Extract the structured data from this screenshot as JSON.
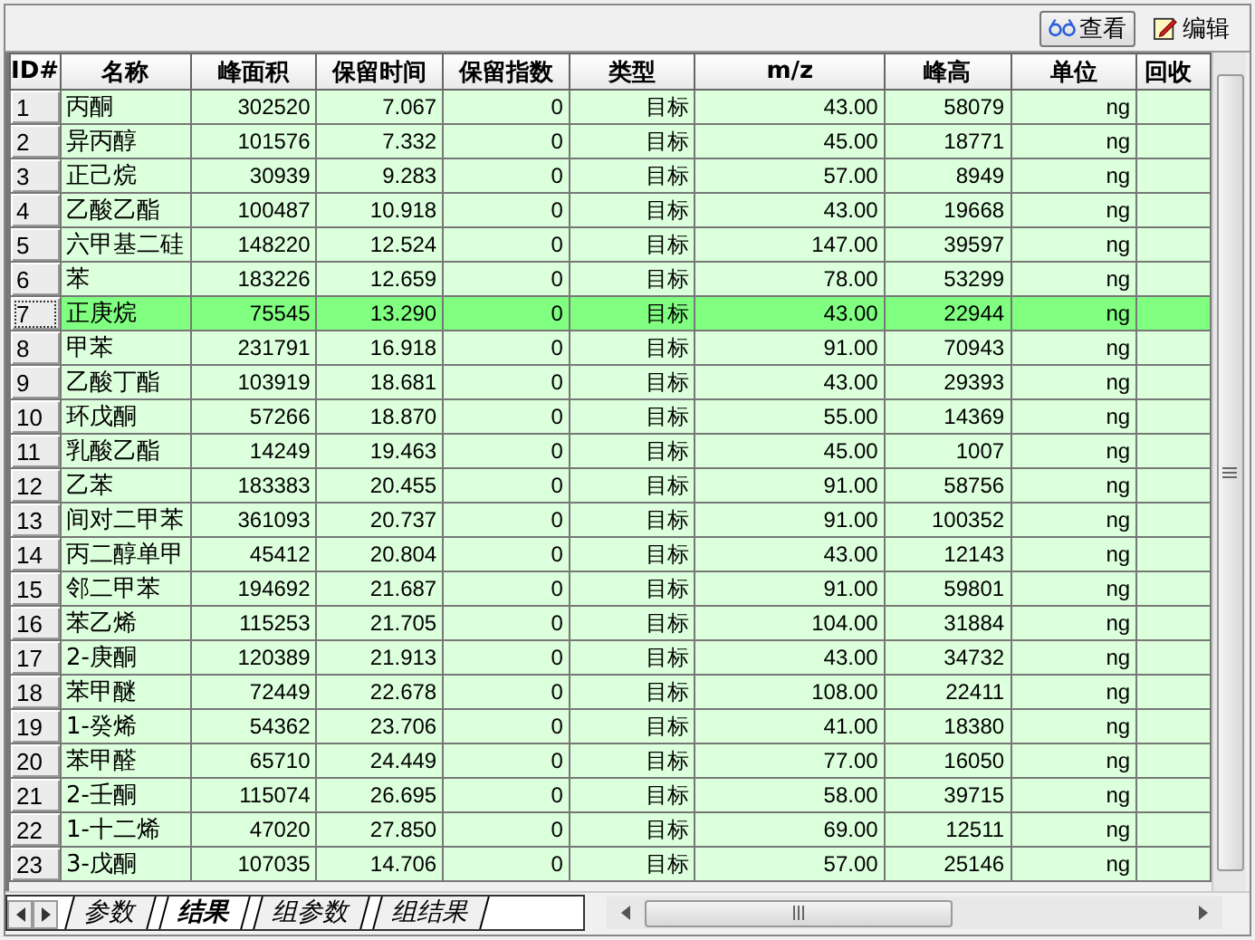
{
  "toolbar": {
    "buttons": [
      {
        "label": "查看",
        "kind": "view",
        "pressed": true
      },
      {
        "label": "编辑",
        "kind": "edit",
        "pressed": false
      }
    ]
  },
  "table": {
    "columns": [
      {
        "label": "ID#"
      },
      {
        "label": "名称"
      },
      {
        "label": "峰面积"
      },
      {
        "label": "保留时间"
      },
      {
        "label": "保留指数"
      },
      {
        "label": "类型"
      },
      {
        "label": "m/z"
      },
      {
        "label": "峰高"
      },
      {
        "label": "单位"
      },
      {
        "label": "回收"
      }
    ],
    "rows": [
      {
        "cells": [
          "1",
          "丙酮",
          "302520",
          "7.067",
          "0",
          "目标",
          "43.00",
          "58079",
          "ng"
        ],
        "selected": false
      },
      {
        "cells": [
          "2",
          "异丙醇",
          "101576",
          "7.332",
          "0",
          "目标",
          "45.00",
          "18771",
          "ng"
        ],
        "selected": false
      },
      {
        "cells": [
          "3",
          "正己烷",
          "30939",
          "9.283",
          "0",
          "目标",
          "57.00",
          "8949",
          "ng"
        ],
        "selected": false
      },
      {
        "cells": [
          "4",
          "乙酸乙酯",
          "100487",
          "10.918",
          "0",
          "目标",
          "43.00",
          "19668",
          "ng"
        ],
        "selected": false
      },
      {
        "cells": [
          "5",
          "六甲基二硅",
          "148220",
          "12.524",
          "0",
          "目标",
          "147.00",
          "39597",
          "ng"
        ],
        "selected": false
      },
      {
        "cells": [
          "6",
          "苯",
          "183226",
          "12.659",
          "0",
          "目标",
          "78.00",
          "53299",
          "ng"
        ],
        "selected": false
      },
      {
        "cells": [
          "7",
          "正庚烷",
          "75545",
          "13.290",
          "0",
          "目标",
          "43.00",
          "22944",
          "ng"
        ],
        "selected": true
      },
      {
        "cells": [
          "8",
          "甲苯",
          "231791",
          "16.918",
          "0",
          "目标",
          "91.00",
          "70943",
          "ng"
        ],
        "selected": false
      },
      {
        "cells": [
          "9",
          "乙酸丁酯",
          "103919",
          "18.681",
          "0",
          "目标",
          "43.00",
          "29393",
          "ng"
        ],
        "selected": false
      },
      {
        "cells": [
          "10",
          "环戊酮",
          "57266",
          "18.870",
          "0",
          "目标",
          "55.00",
          "14369",
          "ng"
        ],
        "selected": false
      },
      {
        "cells": [
          "11",
          "乳酸乙酯",
          "14249",
          "19.463",
          "0",
          "目标",
          "45.00",
          "1007",
          "ng"
        ],
        "selected": false
      },
      {
        "cells": [
          "12",
          "乙苯",
          "183383",
          "20.455",
          "0",
          "目标",
          "91.00",
          "58756",
          "ng"
        ],
        "selected": false
      },
      {
        "cells": [
          "13",
          "间对二甲苯",
          "361093",
          "20.737",
          "0",
          "目标",
          "91.00",
          "100352",
          "ng"
        ],
        "selected": false
      },
      {
        "cells": [
          "14",
          "丙二醇单甲",
          "45412",
          "20.804",
          "0",
          "目标",
          "43.00",
          "12143",
          "ng"
        ],
        "selected": false
      },
      {
        "cells": [
          "15",
          "邻二甲苯",
          "194692",
          "21.687",
          "0",
          "目标",
          "91.00",
          "59801",
          "ng"
        ],
        "selected": false
      },
      {
        "cells": [
          "16",
          "苯乙烯",
          "115253",
          "21.705",
          "0",
          "目标",
          "104.00",
          "31884",
          "ng"
        ],
        "selected": false
      },
      {
        "cells": [
          "17",
          "2-庚酮",
          "120389",
          "21.913",
          "0",
          "目标",
          "43.00",
          "34732",
          "ng"
        ],
        "selected": false
      },
      {
        "cells": [
          "18",
          "苯甲醚",
          "72449",
          "22.678",
          "0",
          "目标",
          "108.00",
          "22411",
          "ng"
        ],
        "selected": false
      },
      {
        "cells": [
          "19",
          "1-癸烯",
          "54362",
          "23.706",
          "0",
          "目标",
          "41.00",
          "18380",
          "ng"
        ],
        "selected": false
      },
      {
        "cells": [
          "20",
          "苯甲醛",
          "65710",
          "24.449",
          "0",
          "目标",
          "77.00",
          "16050",
          "ng"
        ],
        "selected": false
      },
      {
        "cells": [
          "21",
          "2-壬酮",
          "115074",
          "26.695",
          "0",
          "目标",
          "58.00",
          "39715",
          "ng"
        ],
        "selected": false
      },
      {
        "cells": [
          "22",
          "1-十二烯",
          "47020",
          "27.850",
          "0",
          "目标",
          "69.00",
          "12511",
          "ng"
        ],
        "selected": false
      },
      {
        "cells": [
          "23",
          "3-戊酮",
          "107035",
          "14.706",
          "0",
          "目标",
          "57.00",
          "25146",
          "ng"
        ],
        "selected": false
      }
    ]
  },
  "sheet_tabs": [
    {
      "label": "参数",
      "selected": false
    },
    {
      "label": "结果",
      "selected": true
    },
    {
      "label": "组参数",
      "selected": false
    },
    {
      "label": "组结果",
      "selected": false
    }
  ]
}
